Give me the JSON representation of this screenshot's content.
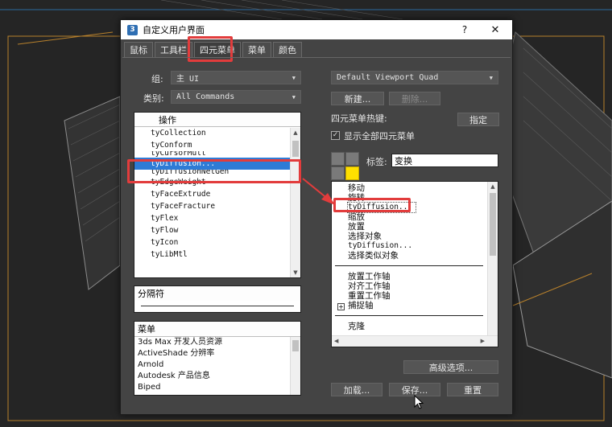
{
  "dialog": {
    "title": "自定义用户界面",
    "help_glyph": "?",
    "close_glyph": "✕",
    "app_icon_glyph": "3"
  },
  "tabs": [
    {
      "label": "鼠标"
    },
    {
      "label": "工具栏"
    },
    {
      "label": "四元菜单",
      "active": true
    },
    {
      "label": "菜单"
    },
    {
      "label": "颜色"
    }
  ],
  "left": {
    "group_label": "组:",
    "group_value": "主 UI",
    "category_label": "类别:",
    "category_value": "All Commands",
    "actions_header": "操作",
    "actions": [
      "tyCollection",
      "tyConform",
      "tyCursorMull",
      "tyDiffusion...",
      "tyDiffusionNetGen",
      "tyEdgeWeight",
      "tyFaceExtrude",
      "tyFaceFracture",
      "tyFlex",
      "tyFlow",
      "tyIcon",
      "tyLibMtl"
    ],
    "selected_action": "tyDiffusion...",
    "separator_header": "分隔符",
    "menus_header": "菜单",
    "menus": [
      "3ds Max 开发人员资源",
      "ActiveShade 分辨率",
      "Arnold",
      "Autodesk 产品信息",
      "Biped"
    ]
  },
  "right": {
    "quad_set_value": "Default Viewport Quad",
    "new_button": "新建...",
    "delete_button": "删除...",
    "hotkey_label": "四元菜单热键:",
    "assign_button": "指定",
    "show_all_label": "显示全部四元菜单",
    "show_all_checked": true,
    "label_caption": "标签:",
    "label_value": "变换",
    "quad_items": [
      "移动",
      "旋转",
      "tyDiffusion...",
      "缩放",
      "放置",
      "选择对象",
      "tyDiffusion...",
      "选择类似对象"
    ],
    "quad_items_2": [
      "放置工作轴",
      "对齐工作轴",
      "重置工作轴"
    ],
    "snap_item": "捕捉轴",
    "clone_item": "克隆",
    "advanced_button": "高级选项...",
    "load_button": "加载...",
    "save_button": "保存...",
    "reset_button": "重置"
  },
  "colors": {
    "annotation_red": "#e23c3c",
    "selection_blue": "#2e7bd6",
    "active_quad_yellow": "#ffe000"
  }
}
